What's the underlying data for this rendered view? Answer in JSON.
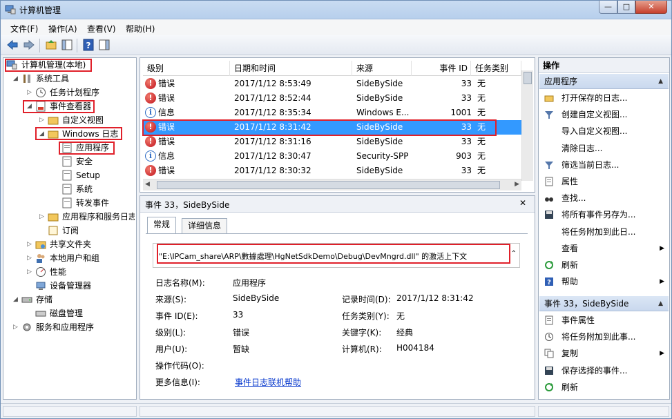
{
  "window": {
    "title": "计算机管理",
    "min": "—",
    "max": "□",
    "close": "✕"
  },
  "menu": [
    "文件(F)",
    "操作(A)",
    "查看(V)",
    "帮助(H)"
  ],
  "tree": {
    "root": "计算机管理(本地)",
    "system_tools": "系统工具",
    "task_scheduler": "任务计划程序",
    "event_viewer": "事件查看器",
    "custom_views": "自定义视图",
    "windows_logs": "Windows 日志",
    "application": "应用程序",
    "security": "安全",
    "setup": "Setup",
    "system": "系统",
    "forwarded": "转发事件",
    "app_service_logs": "应用程序和服务日志",
    "subscriptions": "订阅",
    "shared_folders": "共享文件夹",
    "local_users": "本地用户和组",
    "performance": "性能",
    "device_manager": "设备管理器",
    "storage": "存储",
    "disk_mgmt": "磁盘管理",
    "services_apps": "服务和应用程序"
  },
  "events": {
    "columns": [
      "级别",
      "日期和时间",
      "来源",
      "事件 ID",
      "任务类别"
    ],
    "rows": [
      {
        "level": "错误",
        "kind": "error",
        "datetime": "2017/1/12 8:53:49",
        "source": "SideBySide",
        "id": "33",
        "task": "无"
      },
      {
        "level": "错误",
        "kind": "error",
        "datetime": "2017/1/12 8:52:44",
        "source": "SideBySide",
        "id": "33",
        "task": "无"
      },
      {
        "level": "信息",
        "kind": "info",
        "datetime": "2017/1/12 8:35:34",
        "source": "Windows E...",
        "id": "1001",
        "task": "无"
      },
      {
        "level": "错误",
        "kind": "error",
        "datetime": "2017/1/12 8:31:42",
        "source": "SideBySide",
        "id": "33",
        "task": "无"
      },
      {
        "level": "错误",
        "kind": "error",
        "datetime": "2017/1/12 8:31:16",
        "source": "SideBySide",
        "id": "33",
        "task": "无"
      },
      {
        "level": "信息",
        "kind": "info",
        "datetime": "2017/1/12 8:30:47",
        "source": "Security-SPP",
        "id": "903",
        "task": "无"
      },
      {
        "level": "错误",
        "kind": "error",
        "datetime": "2017/1/12 8:30:32",
        "source": "SideBySide",
        "id": "33",
        "task": "无"
      }
    ],
    "selected_index": 3
  },
  "detail": {
    "header": "事件 33，SideBySide",
    "close": "✕",
    "tabs": [
      "常规",
      "详细信息"
    ],
    "message": "\"E:\\IPCam_share\\ARP\\數據處理\\HgNetSdkDemo\\Debug\\DevMngrd.dll\" 的激活上下文",
    "fields": {
      "log_name_label": "日志名称(M):",
      "log_name": "应用程序",
      "source_label": "来源(S):",
      "source": "SideBySide",
      "logged_label": "记录时间(D):",
      "logged": "2017/1/12 8:31:42",
      "event_id_label": "事件 ID(E):",
      "event_id": "33",
      "task_label": "任务类别(Y):",
      "task": "无",
      "level_label": "级别(L):",
      "level": "错误",
      "keywords_label": "关键字(K):",
      "keywords": "经典",
      "user_label": "用户(U):",
      "user": "暂缺",
      "computer_label": "计算机(R):",
      "computer": "H004184",
      "opcode_label": "操作代码(O):",
      "more_info_label": "更多信息(I):",
      "more_info_link": "事件日志联机帮助"
    }
  },
  "actions": {
    "title": "操作",
    "section1": "应用程序",
    "items1": [
      "打开保存的日志...",
      "创建自定义视图...",
      "导入自定义视图...",
      "清除日志...",
      "筛选当前日志...",
      "属性",
      "查找...",
      "将所有事件另存为...",
      "将任务附加到此日...",
      "查看",
      "刷新",
      "帮助"
    ],
    "section2": "事件 33，SideBySide",
    "items2": [
      "事件属性",
      "将任务附加到此事...",
      "复制",
      "保存选择的事件...",
      "刷新"
    ]
  },
  "colors": {
    "error": "#c1121c",
    "info": "#2e6bc4",
    "selection": "#3399ff",
    "highlight": "#e0202a"
  }
}
